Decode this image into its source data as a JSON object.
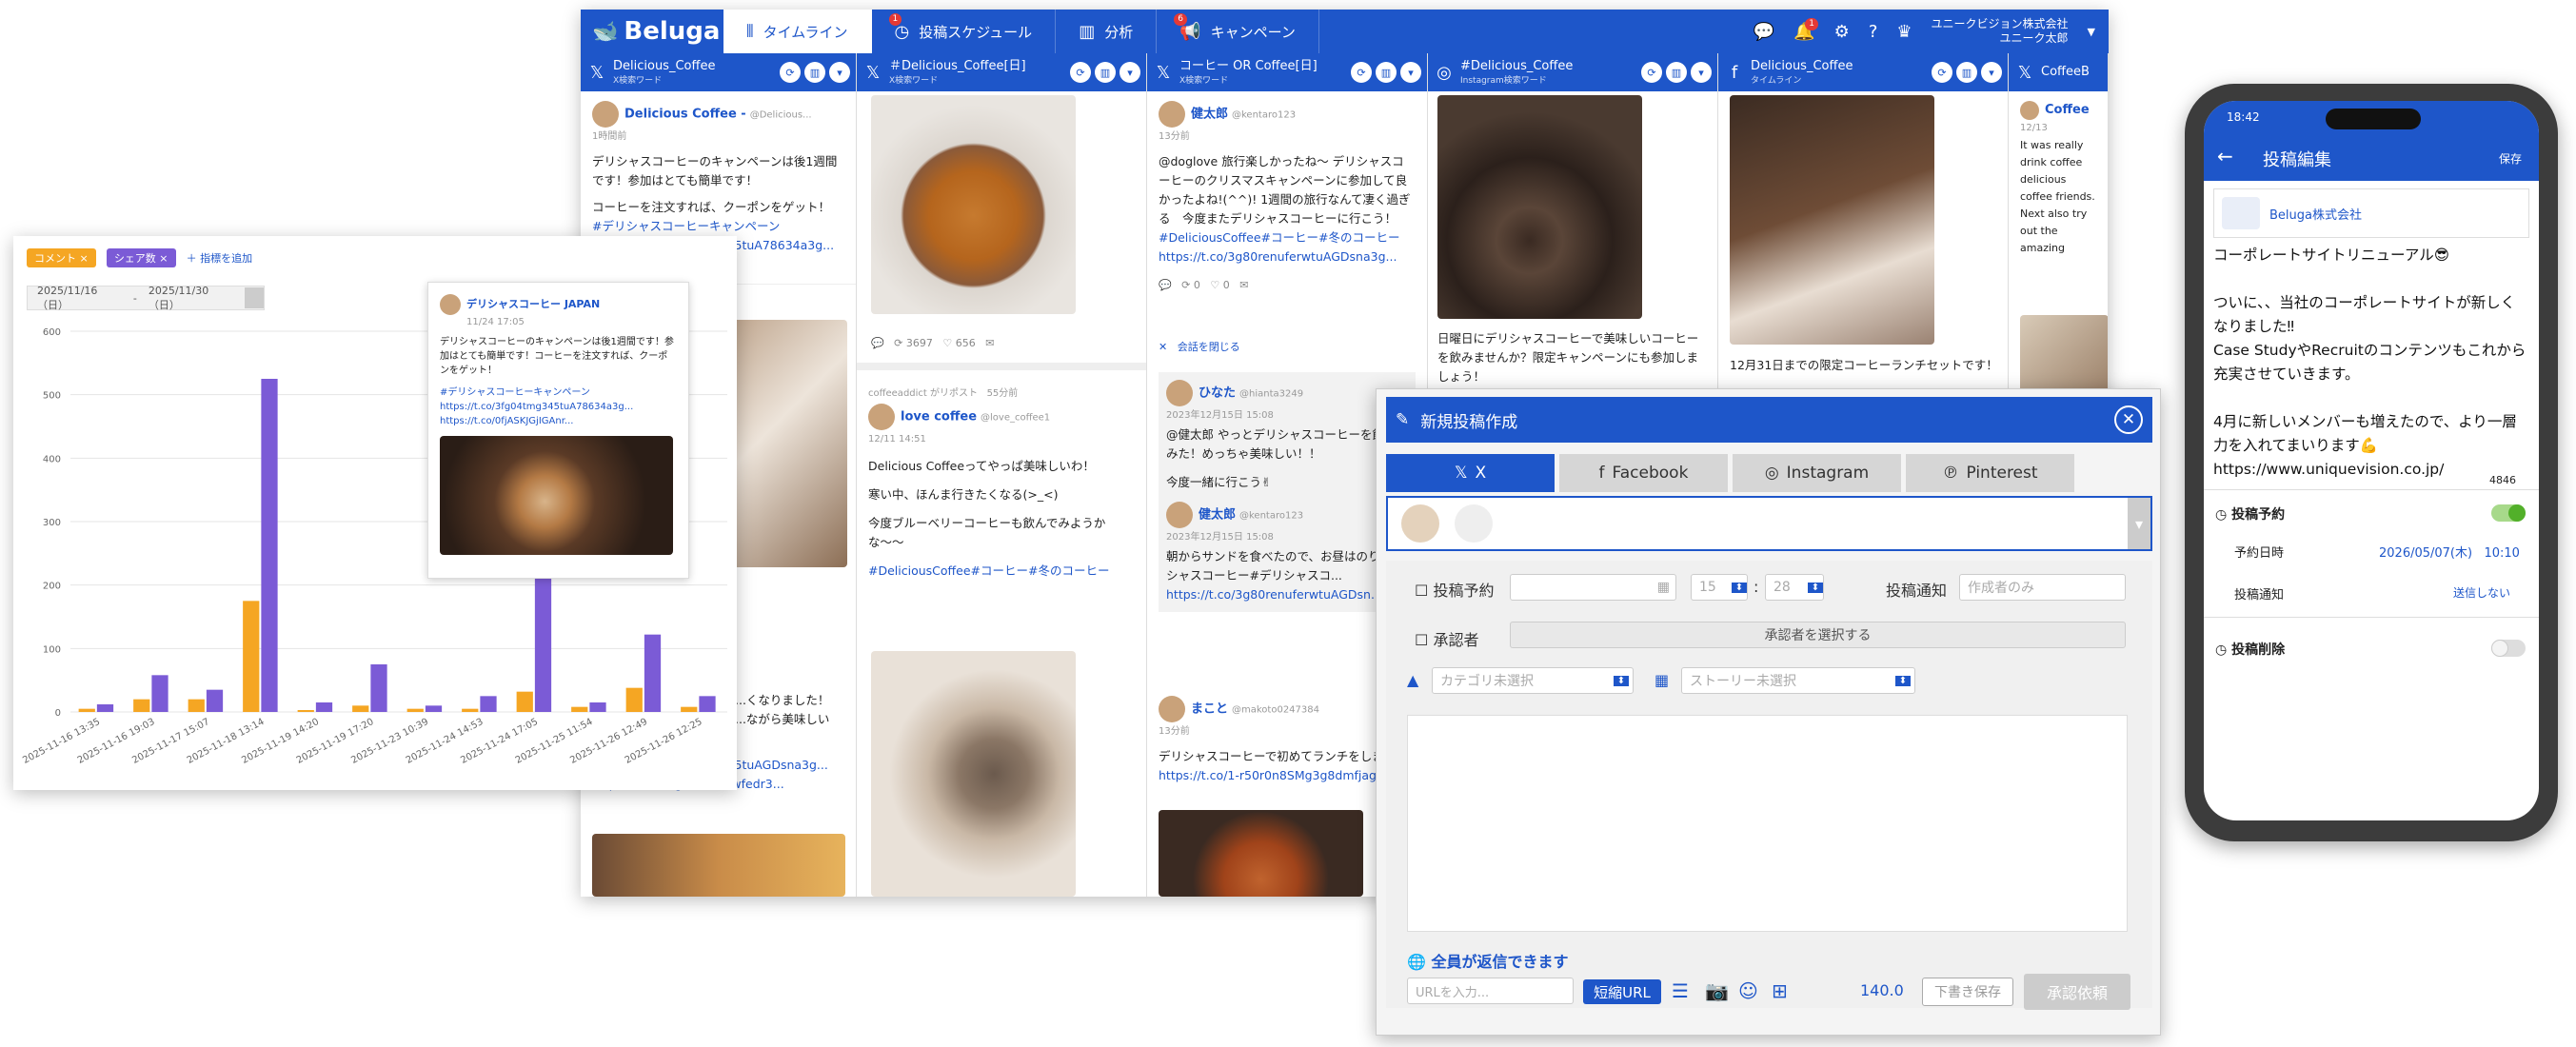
{
  "app": {
    "logo": "Beluga",
    "tabs": [
      {
        "label": "タイムライン",
        "icon": "timeline-icon",
        "badge": ""
      },
      {
        "label": "投稿スケジュール",
        "icon": "clock-icon",
        "badge": "1"
      },
      {
        "label": "分析",
        "icon": "bar-chart-icon",
        "badge": ""
      },
      {
        "label": "キャンペーン",
        "icon": "megaphone-icon",
        "badge": "6"
      }
    ],
    "notif_badge": "1",
    "org_line1": "ユニークビジョン株式会社",
    "org_line2": "ユニーク太郎"
  },
  "columns": [
    {
      "title": "Delicious_Coffee",
      "sub": "X検索ワード",
      "icon": "x-icon"
    },
    {
      "title": "＃Delicious_Coffee[日]",
      "sub": "X検索ワード",
      "icon": "x-icon"
    },
    {
      "title": "コーヒー OR Coffee[日]",
      "sub": "X検索ワード",
      "icon": "x-icon"
    },
    {
      "title": "#Delicious_Coffee",
      "sub": "Instagram検索ワード",
      "icon": "instagram-icon"
    },
    {
      "title": "Delicious_Coffee",
      "sub": "タイムライン",
      "icon": "facebook-icon"
    },
    {
      "title": "CoffeeB",
      "sub": "",
      "icon": "x-icon"
    }
  ],
  "col1": {
    "user": "Delicious Coffee -",
    "handle": "@Delicious...",
    "time": "1時間前",
    "text1": "デリシャスコーヒーのキャンペーンは後1週間です！参加はとても簡単です！",
    "text2": "コーヒーを注文すれば、クーポンをゲット！",
    "tag": "#デリシャスコーヒーキャンペーン",
    "link1": "https://t.co/3fg04tmg345tuA78634a3g...",
    "link2": "...Anr...",
    "text3": "...くなりました！",
    "text4": "...ながら美味しい",
    "link3": "https://t.co/3fg04tmg345tuAGDsna3g...",
    "link4": "https://t.co/sdg0n94mawfedr3..."
  },
  "col2": {
    "stats": [
      "3697",
      "656"
    ],
    "rt_by": "coffeeaddict がリポスト",
    "rt_time": "55分前",
    "user": "love coffee",
    "handle": "@love_coffee1",
    "date": "12/11 14:51",
    "text1": "Delicious Coffeeってやっぱ美味しいわ！",
    "text2": "寒い中、ほんま行きたくなる(>_<)",
    "text3": "今度ブルーベリーコーヒーも飲んでみようかな〜〜",
    "tags": "#DeliciousCoffee#コーヒー#冬のコーヒー"
  },
  "col3": {
    "user": "健太郎",
    "handle": "@kentaro123",
    "time": "13分前",
    "text": "@doglove 旅行楽しかったね〜 デリシャスコーヒーのクリスマスキャンペーンに参加して良かったよね!(^^)! 1週間の旅行なんて凄く過ぎる　今度またデリシャスコーヒーに行こう！",
    "tags": "#DeliciousCoffee#コーヒー#冬のコーヒー",
    "link": "https://t.co/3g80renuferwtuAGDsna3g...",
    "stats": [
      "0",
      "0"
    ],
    "close_thread": "会話を閉じる",
    "r1_user": "ひなた",
    "r1_handle": "@hianta3249",
    "r1_date": "2023年12月15日 15:08",
    "r1_text": "@健太郎 やっとデリシャスコーヒーを飲んでみた！めっちゃ美味しい！！",
    "r1_text2": "今度一緒に行こう✌",
    "r2_user": "健太郎",
    "r2_handle": "@kentaro123",
    "r2_date": "2023年12月15日 15:08",
    "r2_text": "朝からサンドを食べたので、お昼はのりデリシャスコーヒー#デリシャスコ...",
    "r2_link": "https://t.co/3g80renuferwtuAGDsn...",
    "r3_user": "まこと",
    "r3_handle": "@makoto0247384",
    "r3_time": "13分前",
    "r3_text": "デリシャスコーヒーで初めてランチをしました",
    "r3_link": "https://t.co/1-r50r0n8SMg3g8dmfjag..."
  },
  "col4": {
    "text": "日曜日にデリシャスコーヒーで美味しいコーヒーを飲みませんか？限定キャンペーンにも参加しましょう！"
  },
  "col5": {
    "text": "12月31日までの限定コーヒーランチセットです！"
  },
  "col6": {
    "user": "Coffee",
    "date": "12/13",
    "text": "It was really drink coffee delicious coffee friends. Next also try out the amazing"
  },
  "analytics": {
    "chips": [
      "コメント",
      "シェア数"
    ],
    "add": "指標を追加",
    "date_from": "2025/11/16（日）",
    "date_to": "2025/11/30（日）",
    "popup_user": "デリシャスコーヒー JAPAN",
    "popup_date": "11/24 17:05",
    "popup_text": "デリシャスコーヒーのキャンペーンは後1週間です！参加はとても簡単です！コーヒーを注文すれば、クーポンをゲット！",
    "popup_tag": "#デリシャスコーヒーキャンペーン",
    "popup_link1": "https://t.co/3fg04tmg345tuA78634a3g...",
    "popup_link2": "https://t.co/0fjASKJGjIGAnr..."
  },
  "chart_data": {
    "type": "bar",
    "ylim": [
      0,
      600
    ],
    "yticks": [
      "600",
      "500",
      "400",
      "300",
      "200",
      "100",
      "0"
    ],
    "categories": [
      "2025-11-16 13:35",
      "2025-11-16 19:03",
      "2025-11-17 15:07",
      "2025-11-18 13:14",
      "2025-11-19 14:20",
      "2025-11-19 17:20",
      "2025-11-23 10:39",
      "2025-11-24 14:53",
      "2025-11-24 17:05",
      "2025-11-25 11:54",
      "2025-11-26 12:49",
      "2025-11-26 12:25"
    ],
    "series": [
      {
        "name": "コメント",
        "color": "#f5a623",
        "values": [
          5,
          20,
          20,
          175,
          3,
          10,
          5,
          5,
          32,
          8,
          38,
          8
        ]
      },
      {
        "name": "シェア数",
        "color": "#7b5bd6",
        "values": [
          12,
          58,
          35,
          525,
          15,
          75,
          10,
          25,
          230,
          15,
          122,
          25
        ]
      }
    ]
  },
  "compose": {
    "title": "新規投稿作成",
    "tabs": [
      "X",
      "Facebook",
      "Instagram",
      "Pinterest"
    ],
    "schedule": "投稿予約",
    "time_h": "15",
    "time_m": "28",
    "notify": "投稿通知",
    "notify_ph": "作成者のみ",
    "approver": "承認者",
    "approver_btn": "承認者を選択する",
    "category": "カテゴリ未選択",
    "story": "ストーリー未選択",
    "reply": "全員が返信できます",
    "url_ph": "URLを入力...",
    "short_url": "短縮URL",
    "count": "140.0",
    "draft": "下書き保存",
    "submit": "承認依頼"
  },
  "phone": {
    "time": "18:42",
    "title": "投稿編集",
    "save": "保存",
    "account": "Beluga株式会社",
    "text": "コーポレートサイトリニューアル😎\n\nついに、、当社のコーポレートサイトが新しくなりました‼\nCase StudyやRecruitのコンテンツもこれから充実させていきます。\n\n4月に新しいメンバーも増えたので、より一層力を入れてまいります💪\nhttps://www.uniquevision.co.jp/",
    "count": "4846",
    "schedule": "投稿予約",
    "sched_label": "予約日時",
    "sched_date": "2026/05/07(木)",
    "sched_time": "10:10",
    "notify_label": "投稿通知",
    "notify_val": "送信しない",
    "delete": "投稿削除"
  }
}
